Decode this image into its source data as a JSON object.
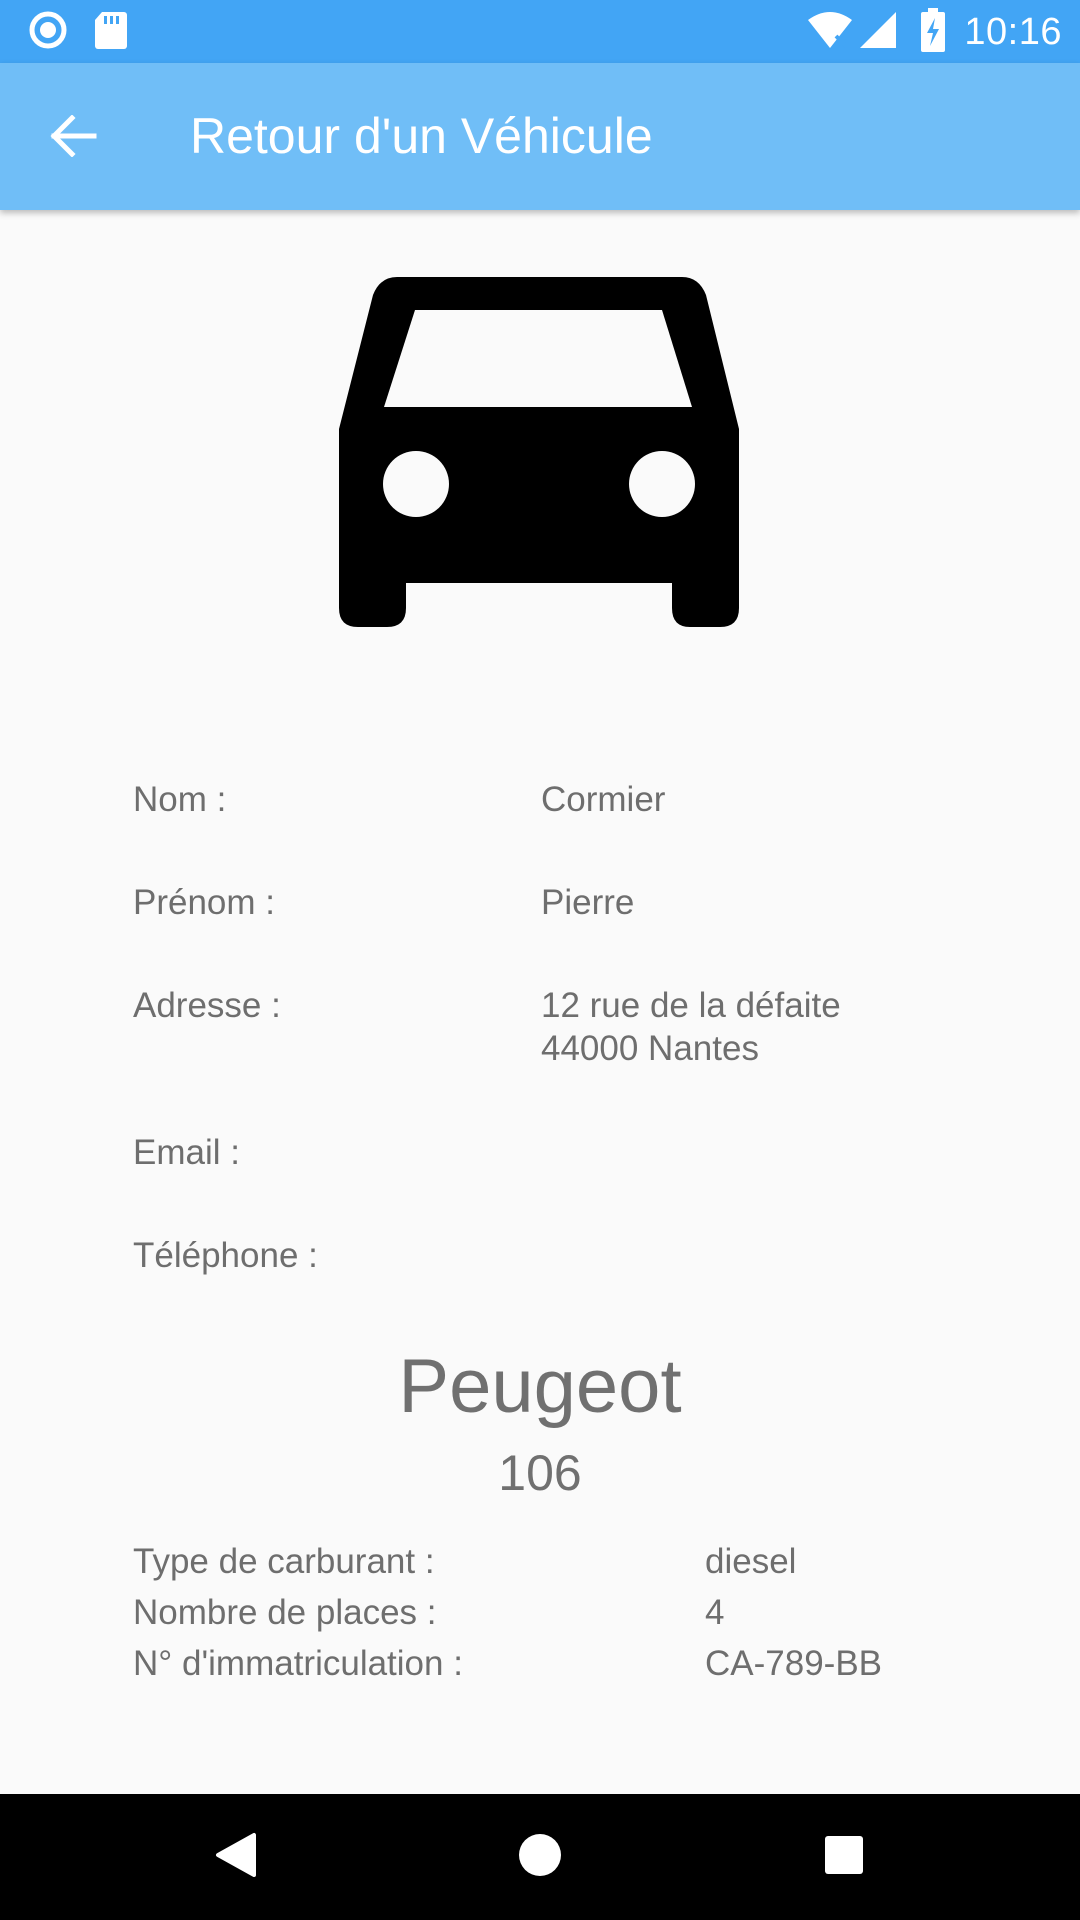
{
  "status_bar": {
    "time": "10:16",
    "icons": [
      "record-icon",
      "sd-card-icon",
      "wifi-icon",
      "signal-icon",
      "battery-charging-icon"
    ]
  },
  "app_bar": {
    "title": "Retour d'un Véhicule",
    "back_icon": "arrow-back-icon"
  },
  "car_icon": "directions-car-icon",
  "client": {
    "name_label": "Nom :",
    "name_value": "Cormier",
    "firstname_label": "Prénom :",
    "firstname_value": "Pierre",
    "address_label": "Adresse :",
    "address_line1": "12 rue de la défaite",
    "address_line2": "44000 Nantes",
    "email_label": "Email :",
    "email_value": "",
    "phone_label": "Téléphone :",
    "phone_value": ""
  },
  "vehicle": {
    "brand": "Peugeot",
    "model": "106",
    "fuel_label": "Type de carburant :",
    "fuel_value": "diesel",
    "seats_label": "Nombre de places :",
    "seats_value": "4",
    "plate_label": "N° d'immatriculation :",
    "plate_value": "CA-789-BB"
  },
  "nav_bar": {
    "icons": [
      "back-triangle-icon",
      "home-circle-icon",
      "recents-square-icon"
    ]
  },
  "colors": {
    "status_bar": "#42a5f5",
    "app_bar": "#70bef7",
    "background": "#fafafa",
    "text": "#6e6e6e"
  }
}
